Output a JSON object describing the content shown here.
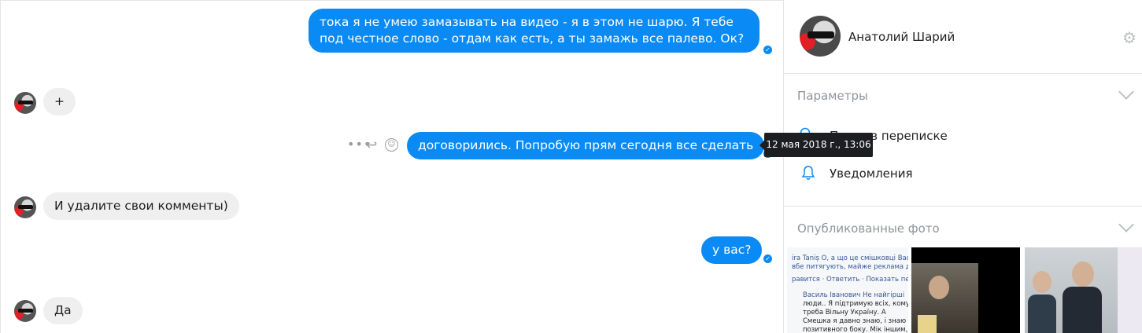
{
  "chat": {
    "messages": [
      {
        "text": "тока я не умею замазывать на видео - я в этом не шарю. Я тебе под честное слово - отдам как есть, а ты замажь все палево. Ок?",
        "direction": "out"
      },
      {
        "text": "+",
        "direction": "in"
      },
      {
        "text": "договорились. Попробую прям сегодня все сделать",
        "direction": "out"
      },
      {
        "text": "И удалите свои комменты)",
        "direction": "in"
      },
      {
        "text": "у вас?",
        "direction": "out"
      },
      {
        "text": "Да",
        "direction": "in"
      }
    ],
    "hover_actions": {
      "more_icon": "more-icon",
      "reply_icon": "reply-icon",
      "react_icon": "smile-icon"
    },
    "tooltip": "12 мая 2018 г., 13:06",
    "accent_color": "#0a8af5",
    "incoming_color": "#efefef"
  },
  "panel": {
    "contact_name": "Анатолий Шарий",
    "settings_icon": "gear-icon",
    "options": {
      "title": "Параметры",
      "items": [
        {
          "label": "Поиск в переписке",
          "icon": "search-icon"
        },
        {
          "label": "Уведомления",
          "icon": "bell-icon"
        }
      ]
    },
    "photos": {
      "title": "Опубликованные фото",
      "thumb1_lines": [
        "ira Taniș О, а що це смішковці Вас до",
        "вбе питягують, майже реклама до ВР",
        "равится · Ответить · Показать перевод",
        "Василь Іванович Не найгірші",
        "люди.. Я підтримую всіх, кому",
        "треба Вільну Україну. А",
        "Смешка я давно знаю, і знаю з",
        "позитивного боку. Мік іншим,"
      ]
    }
  }
}
